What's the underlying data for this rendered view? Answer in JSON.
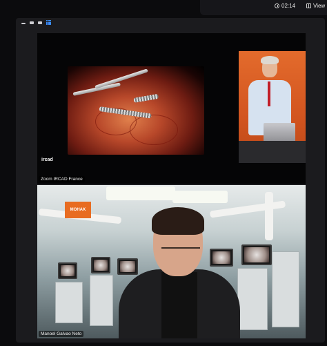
{
  "topbar": {
    "timer": "02:14",
    "view_label": "View"
  },
  "tiles": {
    "top": {
      "label": "Zoom IRCAD France",
      "watermark": "ircad"
    },
    "bottom": {
      "label": "Manoel Galvao Neto",
      "logo_text": "MOHAK"
    }
  },
  "colors": {
    "accent": "#3b8cff",
    "window_bg": "#1b1b1e",
    "logo_orange": "#e86c21"
  },
  "icons": {
    "timer": "clock-icon",
    "view": "grid-icon",
    "gallery": "gallery-view-icon"
  }
}
